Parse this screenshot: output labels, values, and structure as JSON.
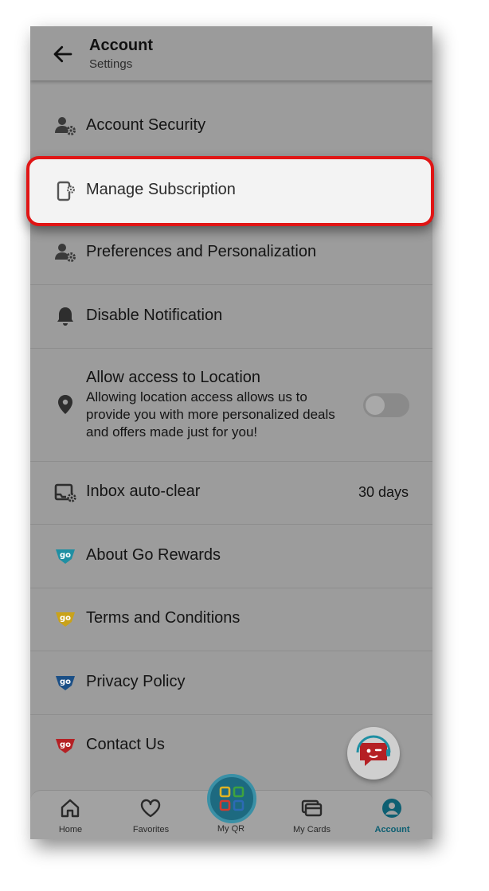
{
  "header": {
    "title": "Account",
    "subtitle": "Settings"
  },
  "menu": {
    "account_security": "Account Security",
    "manage_subscription": "Manage Subscription",
    "preferences": "Preferences and Personalization",
    "disable_notification": "Disable Notification",
    "location_title": "Allow access to Location",
    "location_desc": "Allowing location access allows us to provide you with more personalized deals and offers made just for you!",
    "location_enabled": false,
    "inbox_label": "Inbox auto-clear",
    "inbox_value": "30 days",
    "about": "About Go Rewards",
    "terms": "Terms and Conditions",
    "privacy": "Privacy Policy",
    "contact": "Contact Us"
  },
  "icons": {
    "go_badge": "go",
    "colors": {
      "about": "#1f8fa3",
      "terms": "#c9a21a",
      "privacy": "#1b4f86",
      "contact": "#b52024",
      "highlight_border": "#e01515",
      "active_tab": "#0d5f72"
    }
  },
  "nav": {
    "home": "Home",
    "favorites": "Favorites",
    "qr": "My QR",
    "cards": "My Cards",
    "account": "Account",
    "active": "Account"
  }
}
